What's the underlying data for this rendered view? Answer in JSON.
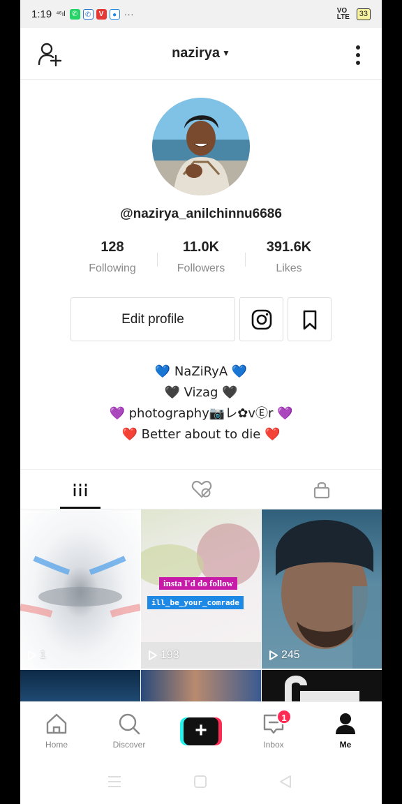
{
  "status_bar": {
    "time": "1:19",
    "signal": "⁴⁶ıl",
    "network": "VO LTE",
    "battery": "33"
  },
  "header": {
    "username": "nazirya"
  },
  "profile": {
    "handle": "@nazirya_anilchinnu6686",
    "stats": [
      {
        "value": "128",
        "label": "Following"
      },
      {
        "value": "11.0K",
        "label": "Followers"
      },
      {
        "value": "391.6K",
        "label": "Likes"
      }
    ],
    "edit_label": "Edit profile",
    "bio": [
      "💙 NaZiRyA 💙",
      "🖤 Vizag 🖤",
      "💜 photography📷レ✿vⒺr 💜",
      "❤️ Better about to die ❤️"
    ]
  },
  "videos": [
    {
      "views": "1",
      "overlay": []
    },
    {
      "views": "193",
      "overlay": [
        "insta I'd do follow",
        "ill_be_your_comrade"
      ]
    },
    {
      "views": "245",
      "overlay": []
    }
  ],
  "bottom_nav": {
    "items": [
      {
        "label": "Home"
      },
      {
        "label": "Discover"
      },
      {
        "label": "Inbox",
        "badge": "1"
      },
      {
        "label": "Me"
      }
    ]
  },
  "colors": {
    "accent_red": "#fe2c55",
    "accent_cyan": "#25f4ee",
    "text": "#222222",
    "muted": "#8a8a8a"
  }
}
